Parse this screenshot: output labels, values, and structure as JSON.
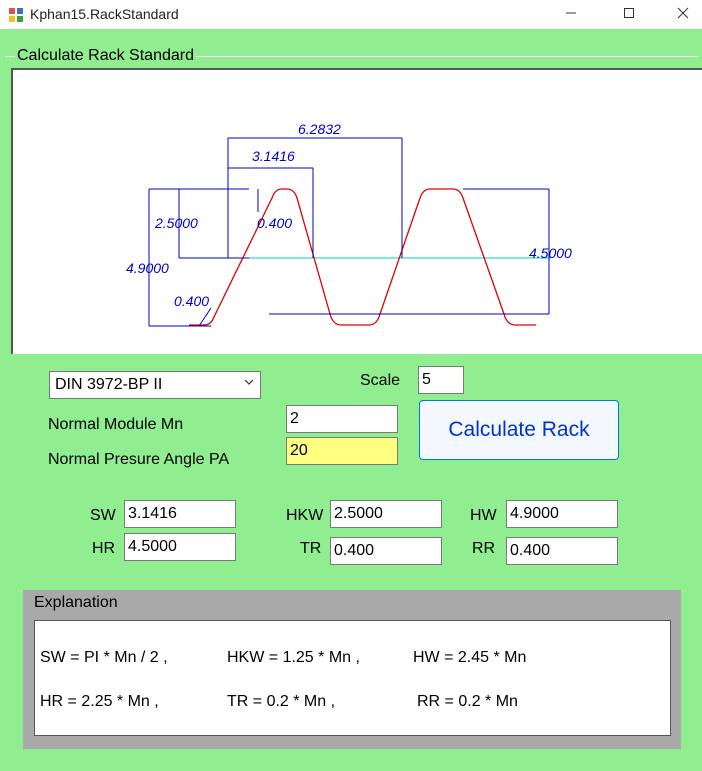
{
  "window": {
    "title": "Kphan15.RackStandard",
    "minimize_icon": "minimize-icon",
    "maximize_icon": "maximize-icon",
    "close_icon": "close-icon"
  },
  "group": {
    "title": "Calculate Rack Standard"
  },
  "drawing": {
    "dim_total_pitch": "6.2832",
    "dim_half_pitch": "3.1416",
    "dim_addendum": "2.5000",
    "dim_tip_radius": "0.400",
    "dim_total_depth": "4.9000",
    "dim_root_radius": "0.400",
    "dim_right_height": "4.5000",
    "colors": {
      "profile": "#e00000",
      "dimension": "#0000cc",
      "pitch_line": "#00cccc"
    }
  },
  "form": {
    "standard_select": "DIN 3972-BP II",
    "scale_label": "Scale",
    "scale_value": "5",
    "module_label": "Normal Module Mn",
    "module_value": "2",
    "pressure_label": "Normal Presure Angle PA",
    "pressure_value": "20",
    "calculate_button": "Calculate Rack"
  },
  "results": {
    "sw_label": "SW",
    "sw_value": "3.1416",
    "hkw_label": "HKW",
    "hkw_value": "2.5000",
    "hw_label": "HW",
    "hw_value": "4.9000",
    "hr_label": "HR",
    "hr_value": "4.5000",
    "tr_label": "TR",
    "tr_value": "0.400",
    "rr_label": "RR",
    "rr_value": "0.400"
  },
  "explanation": {
    "title": "Explanation",
    "line1_a": "SW = PI * Mn / 2 ,",
    "line1_b": "HKW = 1.25 * Mn ,",
    "line1_c": "HW = 2.45 * Mn",
    "line2_a": "HR = 2.25 * Mn ,",
    "line2_b": "TR = 0.2 * Mn ,",
    "line2_c": "RR = 0.2 * Mn"
  }
}
